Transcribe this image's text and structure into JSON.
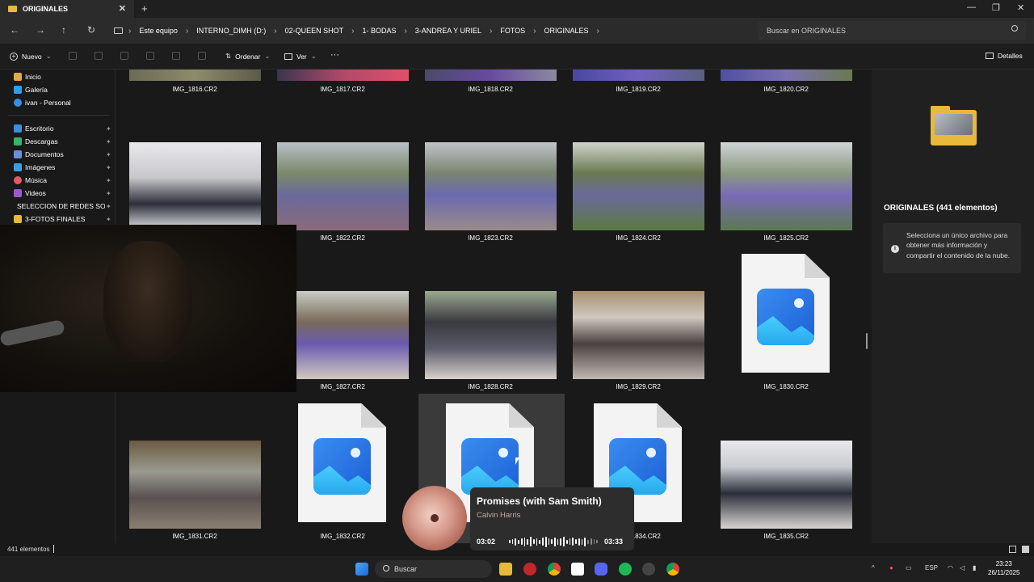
{
  "window": {
    "tab_title": "ORIGINALES",
    "new_tab": "+",
    "close": "✕",
    "minimize": "—",
    "maximize": "❐",
    "close_window": "✕"
  },
  "nav": {
    "back": "←",
    "forward": "→",
    "up": "↑",
    "refresh": "↻"
  },
  "breadcrumb": [
    "Este equipo",
    "INTERNO_DIMH (D:)",
    "02-QUEEN SHOT",
    "1- BODAS",
    "3-ANDREA Y URIEL",
    "FOTOS",
    "ORIGINALES"
  ],
  "search": {
    "placeholder": "Buscar en ORIGINALES"
  },
  "toolbar": {
    "new_label": "Nuevo",
    "sort_label": "Ordenar",
    "view_label": "Ver",
    "more_label": "···",
    "details_label": "Detalles"
  },
  "sidebar": {
    "quick": [
      {
        "label": "Inicio",
        "icon": "home-icon",
        "color": "#e0a84c"
      },
      {
        "label": "Galería",
        "icon": "gallery-icon",
        "color": "#2f9ee8"
      },
      {
        "label": "ivan - Personal",
        "icon": "cloud-icon",
        "color": "#3b8ee0"
      }
    ],
    "pinned": [
      {
        "label": "Escritorio",
        "icon": "desktop-icon",
        "color": "#3b8ee0"
      },
      {
        "label": "Descargas",
        "icon": "download-icon",
        "color": "#36b36b"
      },
      {
        "label": "Documentos",
        "icon": "documents-icon",
        "color": "#6b8fd6"
      },
      {
        "label": "Imágenes",
        "icon": "pictures-icon",
        "color": "#3aa0e0"
      },
      {
        "label": "Música",
        "icon": "music-icon",
        "color": "#e05a6a"
      },
      {
        "label": "Videos",
        "icon": "videos-icon",
        "color": "#9b59d0"
      },
      {
        "label": "SELECCION DE REDES SOCIA",
        "icon": "folder-icon",
        "color": "#e8b93a"
      },
      {
        "label": "3-FOTOS FINALES",
        "icon": "folder-icon",
        "color": "#e8b93a"
      }
    ]
  },
  "files": {
    "row1": [
      "IMG_1816.CR2",
      "IMG_1817.CR2",
      "IMG_1818.CR2",
      "IMG_1819.CR2",
      "IMG_1820.CR2"
    ],
    "row2": [
      "IMG_1822.CR2",
      "IMG_1823.CR2",
      "IMG_1824.CR2",
      "IMG_1825.CR2"
    ],
    "row3": [
      "IMG_1827.CR2",
      "IMG_1828.CR2",
      "IMG_1829.CR2",
      "IMG_1830.CR2"
    ],
    "row4": [
      "IMG_1831.CR2",
      "IMG_1832.CR2",
      "IMG_1834.CR2",
      "IMG_1835.CR2"
    ]
  },
  "details": {
    "title": "ORIGINALES (441 elementos)",
    "info": "Selecciona un único archivo para obtener más información y compartir el contenido de la nube."
  },
  "status": {
    "count": "441 elementos"
  },
  "media": {
    "title": "Promises (with Sam Smith)",
    "artist": "Calvin Harris",
    "current": "03:02",
    "total": "03:33",
    "progress": 0.86
  },
  "taskbar": {
    "search_label": "Buscar",
    "language": "ESP",
    "time": "23:23",
    "date": "26/11/2025"
  }
}
